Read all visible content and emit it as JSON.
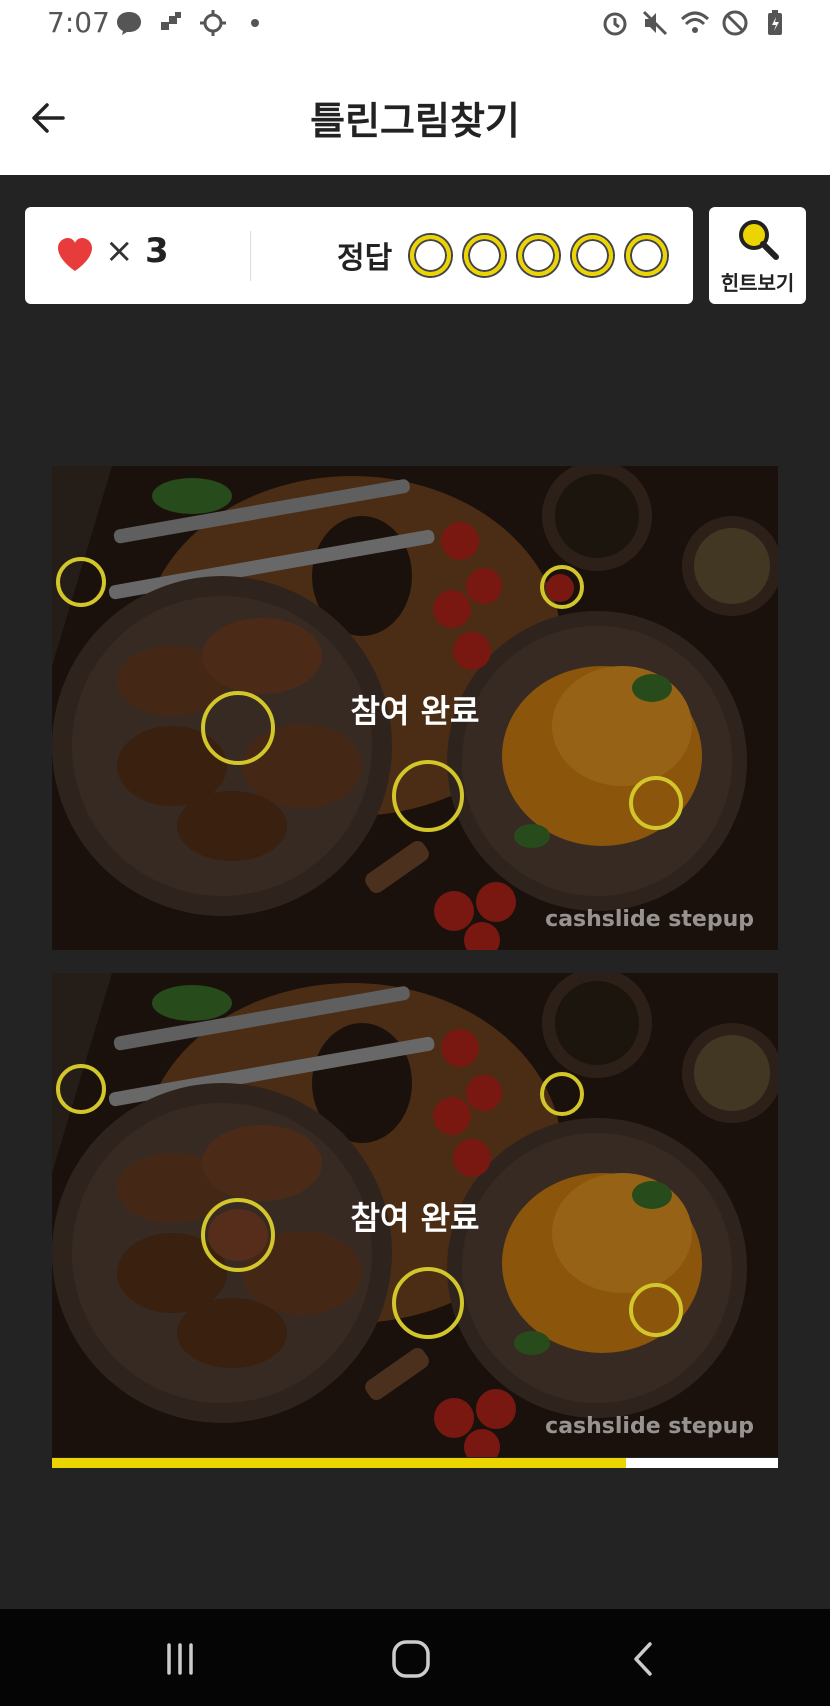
{
  "status_bar": {
    "time": "7:07",
    "left_icons": [
      "messenger-icon",
      "app-icon",
      "settings-icon",
      "dot-icon"
    ],
    "right_icons": [
      "alarm-icon",
      "mute-icon",
      "wifi-icon",
      "no-sim-icon",
      "battery-icon"
    ]
  },
  "header": {
    "title": "틀린그림찾기",
    "back_icon": "back-arrow-icon"
  },
  "info_panel": {
    "times_symbol": "×",
    "lives": "3",
    "answer_label": "정답",
    "answer_slots": 5,
    "colors": {
      "heart": "#e83c3c",
      "accent": "#ecd400"
    }
  },
  "hint_button": {
    "label": "힌트보기",
    "icon": "magnifier-icon"
  },
  "images": {
    "top": {
      "complete_label": "참여 완료",
      "watermark": "cashslide stepup"
    },
    "bottom": {
      "complete_label": "참여 완료",
      "watermark": "cashslide stepup"
    }
  },
  "progress": {
    "fraction": 0.79
  },
  "nav_bar": {
    "icons": [
      "recent-apps-icon",
      "home-icon",
      "nav-back-icon"
    ]
  }
}
